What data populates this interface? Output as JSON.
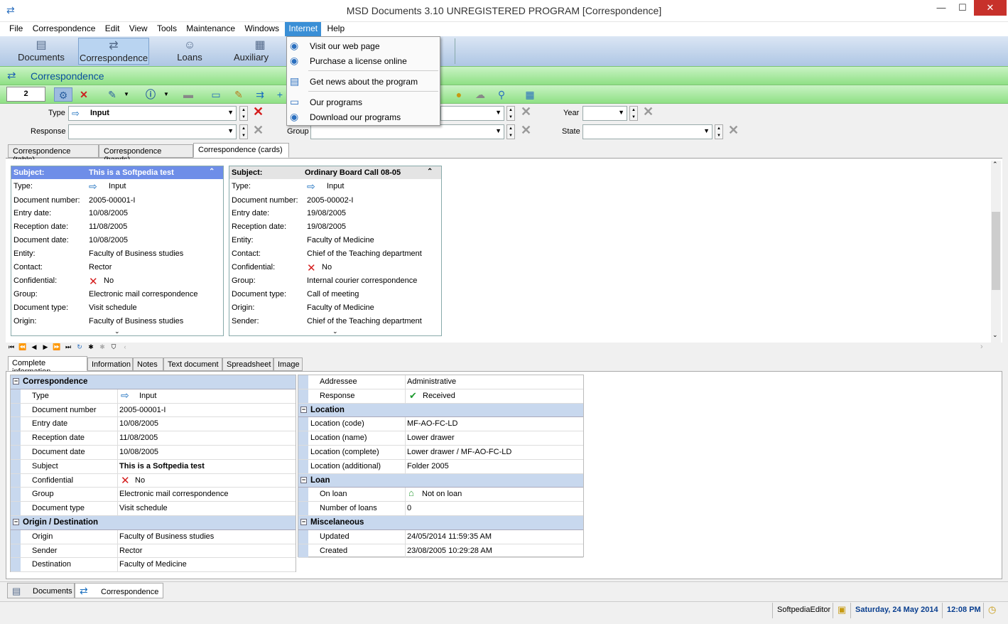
{
  "window": {
    "title": "MSD Documents 3.10 UNREGISTERED PROGRAM [Correspondence]",
    "min": "—",
    "max": "☐",
    "close": "✕"
  },
  "menu": [
    "File",
    "Correspondence",
    "Edit",
    "View",
    "Tools",
    "Maintenance",
    "Windows",
    "Internet",
    "Help"
  ],
  "nav": {
    "documents": "Documents",
    "correspondence": "Correspondence",
    "loans": "Loans",
    "auxiliary": "Auxiliary DBs"
  },
  "section_title": "Correspondence",
  "toolbar": {
    "counter": "2"
  },
  "filters": {
    "type_label": "Type",
    "type_value": "Input",
    "response_label": "Response",
    "response_value": "",
    "year_label": "Year",
    "year_value": "",
    "group_label": "Group",
    "group_value": "",
    "state_label": "State",
    "state_value": ""
  },
  "view_tabs": [
    "Correspondence (table)",
    "Correspondence (bands)",
    "Correspondence (cards)"
  ],
  "cards": [
    {
      "subject_label": "Subject:",
      "subject": "This is a Softpedia test",
      "rows": [
        {
          "k": "Type:",
          "v": "Input"
        },
        {
          "k": "Document number:",
          "v": "2005-00001-I"
        },
        {
          "k": "Entry date:",
          "v": "10/08/2005"
        },
        {
          "k": "Reception date:",
          "v": "11/08/2005"
        },
        {
          "k": "Document date:",
          "v": "10/08/2005"
        },
        {
          "k": "Entity:",
          "v": "Faculty of Business studies"
        },
        {
          "k": "Contact:",
          "v": "Rector"
        },
        {
          "k": "Confidential:",
          "v": "No"
        },
        {
          "k": "Group:",
          "v": "Electronic mail correspondence"
        },
        {
          "k": "Document type:",
          "v": "Visit schedule"
        },
        {
          "k": "Origin:",
          "v": "Faculty of Business studies"
        }
      ]
    },
    {
      "subject_label": "Subject:",
      "subject": "Ordinary Board Call 08-05",
      "rows": [
        {
          "k": "Type:",
          "v": "Input"
        },
        {
          "k": "Document number:",
          "v": "2005-00002-I"
        },
        {
          "k": "Entry date:",
          "v": "19/08/2005"
        },
        {
          "k": "Reception date:",
          "v": "19/08/2005"
        },
        {
          "k": "Entity:",
          "v": "Faculty of Medicine"
        },
        {
          "k": "Contact:",
          "v": "Chief of the Teaching department"
        },
        {
          "k": "Confidential:",
          "v": "No"
        },
        {
          "k": "Group:",
          "v": "Internal courier correspondence"
        },
        {
          "k": "Document type:",
          "v": "Call of meeting"
        },
        {
          "k": "Origin:",
          "v": "Faculty of Medicine"
        },
        {
          "k": "Sender:",
          "v": "Chief of the Teaching department"
        }
      ]
    }
  ],
  "detail_tabs": [
    "Complete information",
    "Information",
    "Notes",
    "Text document",
    "Spreadsheet",
    "Image"
  ],
  "detail_left": [
    {
      "group": "Correspondence"
    },
    {
      "k": "Type",
      "v": "Input"
    },
    {
      "k": "Document number",
      "v": "2005-00001-I"
    },
    {
      "k": "Entry date",
      "v": "10/08/2005"
    },
    {
      "k": "Reception date",
      "v": "11/08/2005"
    },
    {
      "k": "Document date",
      "v": "10/08/2005"
    },
    {
      "k": "Subject",
      "v": "This is a Softpedia test"
    },
    {
      "k": "Confidential",
      "v": "No"
    },
    {
      "k": "Group",
      "v": "Electronic mail correspondence"
    },
    {
      "k": "Document type",
      "v": "Visit schedule"
    },
    {
      "group": "Origin / Destination"
    },
    {
      "k": "Origin",
      "v": "Faculty of Business studies"
    },
    {
      "k": "Sender",
      "v": "Rector"
    },
    {
      "k": "Destination",
      "v": "Faculty of Medicine"
    }
  ],
  "detail_right": [
    {
      "k": "Addressee",
      "v": "Administrative"
    },
    {
      "k": "Response",
      "v": "Received"
    },
    {
      "group": "Location"
    },
    {
      "k": "Location (code)",
      "v": "MF-AO-FC-LD"
    },
    {
      "k": "Location (name)",
      "v": "Lower drawer"
    },
    {
      "k": "Location (complete)",
      "v": "Lower drawer / MF-AO-FC-LD"
    },
    {
      "k": "Location (additional)",
      "v": "Folder 2005"
    },
    {
      "group": "Loan"
    },
    {
      "k": "On loan",
      "v": "Not on loan"
    },
    {
      "k": "Number of loans",
      "v": "0"
    },
    {
      "group": "Miscelaneous"
    },
    {
      "k": "Updated",
      "v": "24/05/2014 11:59:35 AM"
    },
    {
      "k": "Created",
      "v": "23/08/2005 10:29:28 AM"
    }
  ],
  "window_tabs": [
    "Documents",
    "Correspondence"
  ],
  "status": {
    "user": "SoftpediaEditor",
    "date": "Saturday, 24 May 2014",
    "time": "12:08 PM"
  },
  "internet_menu": {
    "items": [
      "Visit our web page",
      "Purchase a license online",
      "Get news about the program",
      "Our programs",
      "Download our programs"
    ]
  }
}
